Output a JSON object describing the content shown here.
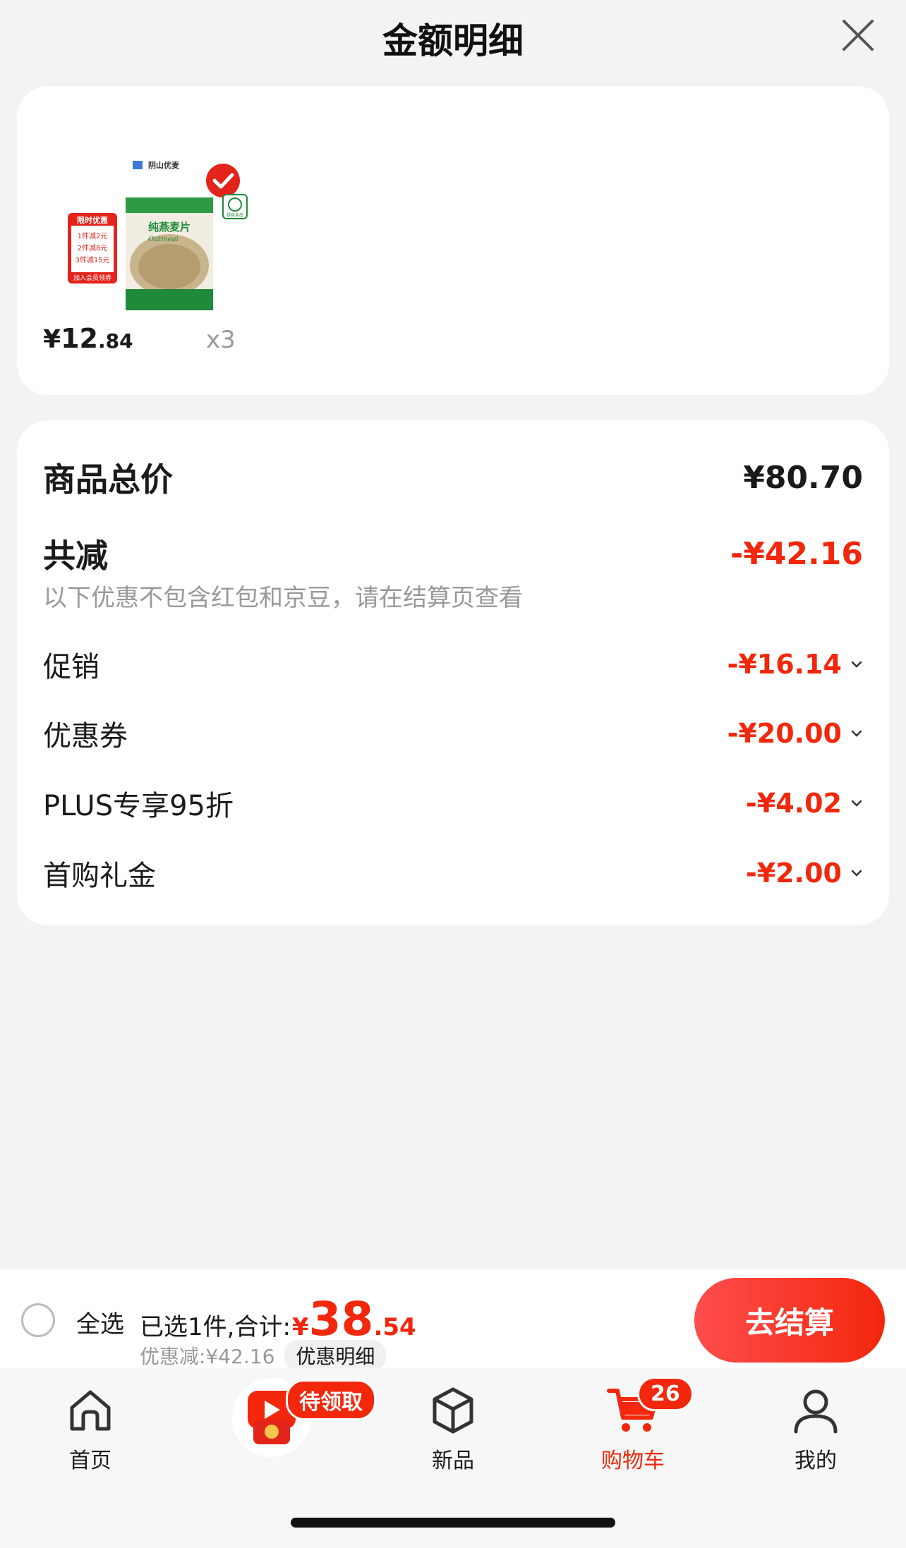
{
  "header": {
    "title": "金额明细"
  },
  "product": {
    "price_symbol": "¥",
    "price_int": "12",
    "price_dec": ".84",
    "qty": "x3",
    "image": {
      "brand": "阴山优麦",
      "name": "纯燕麦片",
      "name_en": "Oatmeal",
      "promo_title": "限时优惠",
      "promo_lines": [
        "1件减2元",
        "2件减8元",
        "3件减15元"
      ],
      "promo_footer": "加入会员领券",
      "green_label": "绿色食品"
    }
  },
  "summary": {
    "total_label": "商品总价",
    "total_value": "¥80.70",
    "reduce_label": "共减",
    "reduce_value": "-¥42.16",
    "note": "以下优惠不包含红包和京豆，请在结算页查看",
    "lines": [
      {
        "label": "促销",
        "value": "-¥16.14"
      },
      {
        "label": "优惠券",
        "value": "-¥20.00"
      },
      {
        "label": "PLUS专享95折",
        "value": "-¥4.02"
      },
      {
        "label": "首购礼金",
        "value": "-¥2.00"
      }
    ]
  },
  "checkout": {
    "select_all": "全选",
    "selected_text": "已选1件,合计:",
    "price_symbol": "¥",
    "price_big": "38",
    "price_small": ".54",
    "saved_text": "优惠减:¥42.16",
    "detail_button": "优惠明细",
    "checkout_button": "去结算"
  },
  "tabbar": {
    "home": "首页",
    "promo_badge": "待领取",
    "new": "新品",
    "cart": "购物车",
    "cart_badge": "26",
    "me": "我的"
  },
  "colors": {
    "accent": "#f2270c",
    "brand_green": "#1f8a3a"
  }
}
